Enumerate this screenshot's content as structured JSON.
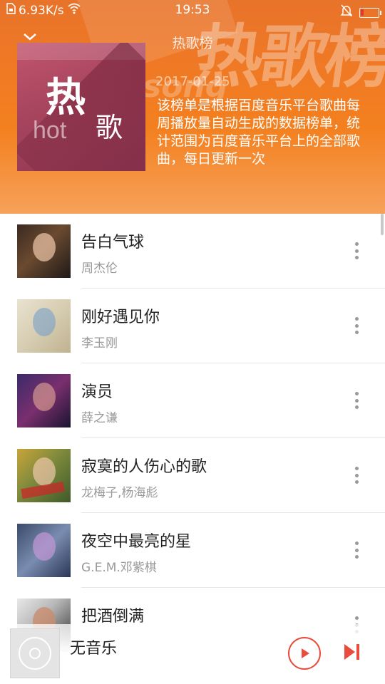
{
  "status_bar": {
    "net_speed": "6.93K/s",
    "time": "19:53",
    "battery_level": 0.15,
    "accent": "#e03a2f"
  },
  "header": {
    "title": "热歌榜",
    "date": "2017-01-25",
    "description": "该榜单是根据百度音乐平台歌曲每周播放量自动生成的数据榜单，统计范围为百度音乐平台上的全部歌曲，每日更新一次",
    "cover": {
      "big_char": "热",
      "small_char": "歌",
      "latin": "hot"
    },
    "background_text": "热歌榜",
    "background_song": "song",
    "brand_color": "#f07a24"
  },
  "songs": [
    {
      "title": "告白气球",
      "artist": "周杰伦"
    },
    {
      "title": "刚好遇见你",
      "artist": "李玉刚"
    },
    {
      "title": "演员",
      "artist": "薛之谦"
    },
    {
      "title": "寂寞的人伤心的歌",
      "artist": "龙梅子,杨海彪"
    },
    {
      "title": "夜空中最亮的星",
      "artist": "G.E.M.邓紫棋"
    },
    {
      "title": "把酒倒满",
      "artist": ""
    }
  ],
  "player": {
    "now_playing": "无音乐",
    "accent": "#e94b3c",
    "icons": [
      "play-icon",
      "next-track-icon",
      "disc-icon"
    ]
  }
}
